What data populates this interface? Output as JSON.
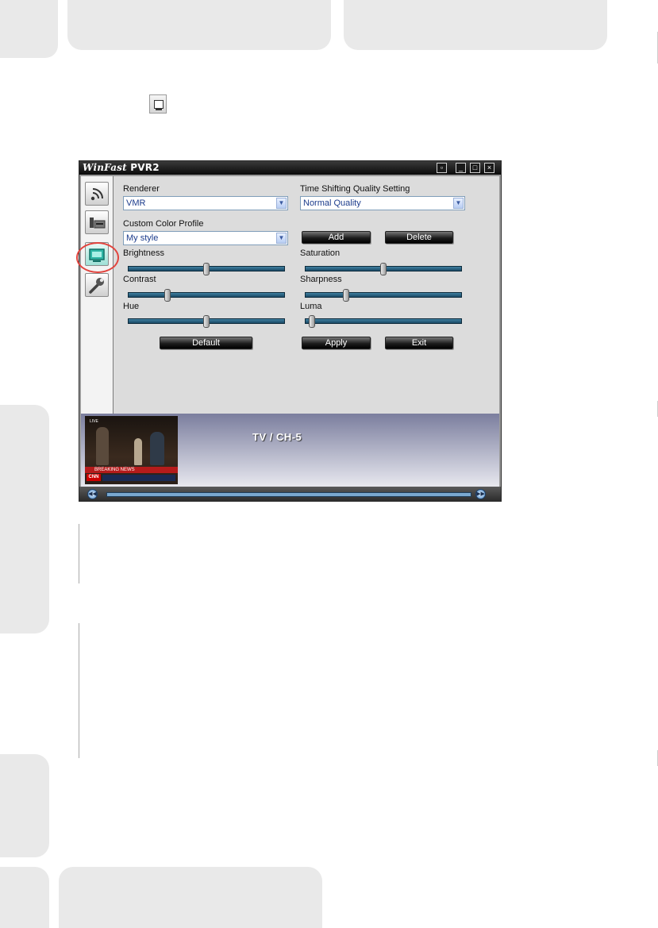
{
  "app": {
    "title": "WinFast",
    "title_suffix": "PVR2",
    "window_buttons": [
      "restore-icon",
      "minimize-icon",
      "maximize-icon",
      "close-icon"
    ]
  },
  "sidebar": {
    "items": [
      {
        "name": "signal",
        "icon": "antenna-icon"
      },
      {
        "name": "capture",
        "icon": "card-icon"
      },
      {
        "name": "display",
        "icon": "tv-icon",
        "selected": true
      },
      {
        "name": "settings",
        "icon": "wrench-icon"
      }
    ]
  },
  "settings": {
    "renderer_label": "Renderer",
    "renderer_value": "VMR",
    "quality_label": "Time Shifting Quality Setting",
    "quality_value": "Normal Quality",
    "profile_label": "Custom Color Profile",
    "profile_value": "My style",
    "add_label": "Add",
    "delete_label": "Delete",
    "default_label": "Default",
    "apply_label": "Apply",
    "exit_label": "Exit",
    "sliders": {
      "brightness": {
        "label": "Brightness",
        "value": 0.5
      },
      "contrast": {
        "label": "Contrast",
        "value": 0.24
      },
      "hue": {
        "label": "Hue",
        "value": 0.5
      },
      "saturation": {
        "label": "Saturation",
        "value": 0.5
      },
      "sharpness": {
        "label": "Sharpness",
        "value": 0.25
      },
      "luma": {
        "label": "Luma",
        "value": 0.02
      }
    }
  },
  "preview": {
    "channel": "TV / CH-5",
    "news_label": "BREAKING NEWS",
    "network": "CNN",
    "live_tag": "LIVE"
  },
  "colors": {
    "accent_ring": "#e2443e",
    "slider_track": "#2b6a8c"
  }
}
